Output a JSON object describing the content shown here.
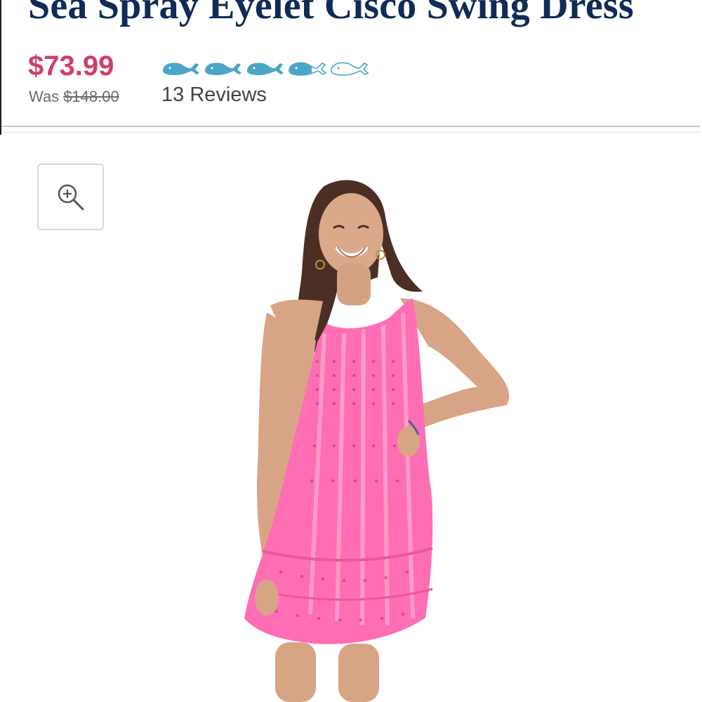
{
  "product": {
    "title": "Sea Spray Eyelet Cisco Swing Dress",
    "sale_price": "$73.99",
    "was_label": "Was",
    "original_price": "$148.00",
    "rating_value": 3.5,
    "rating_max": 5,
    "rating_icon": "whale-icon",
    "reviews_label": "13 Reviews"
  },
  "zoom": {
    "icon": "zoom-in-icon"
  },
  "colors": {
    "title": "#0f2b57",
    "sale_price": "#cf3f68",
    "rating_filled": "#4aa6c6",
    "rating_empty": "#ffffff",
    "dress": "#ff6db4"
  }
}
